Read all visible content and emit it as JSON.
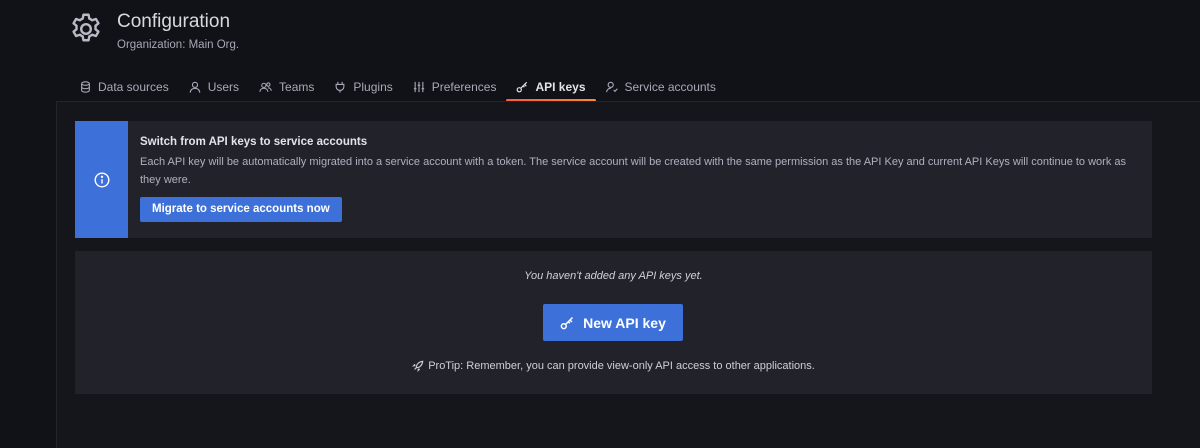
{
  "header": {
    "title": "Configuration",
    "subtitle": "Organization: Main Org.",
    "icon": "gear-icon"
  },
  "tabs": [
    {
      "label": "Data sources",
      "icon": "database-icon",
      "active": false
    },
    {
      "label": "Users",
      "icon": "user-icon",
      "active": false
    },
    {
      "label": "Teams",
      "icon": "users-icon",
      "active": false
    },
    {
      "label": "Plugins",
      "icon": "plug-icon",
      "active": false
    },
    {
      "label": "Preferences",
      "icon": "sliders-icon",
      "active": false
    },
    {
      "label": "API keys",
      "icon": "key-icon",
      "active": true
    },
    {
      "label": "Service accounts",
      "icon": "service-account-icon",
      "active": false
    }
  ],
  "alert": {
    "title": "Switch from API keys to service accounts",
    "text": "Each API key will be automatically migrated into a service account with a token. The service account will be created with the same permission as the API Key and current API Keys will continue to work as they were.",
    "button_label": "Migrate to service accounts now",
    "icon": "info-icon"
  },
  "empty_state": {
    "message": "You haven't added any API keys yet.",
    "button_label": "New API key",
    "protip": "ProTip: Remember, you can provide view-only API access to other applications."
  },
  "colors": {
    "background": "#111217",
    "panel": "#22232a",
    "primary": "#3d71d9",
    "active_tab_underline": "#f55f3e"
  }
}
